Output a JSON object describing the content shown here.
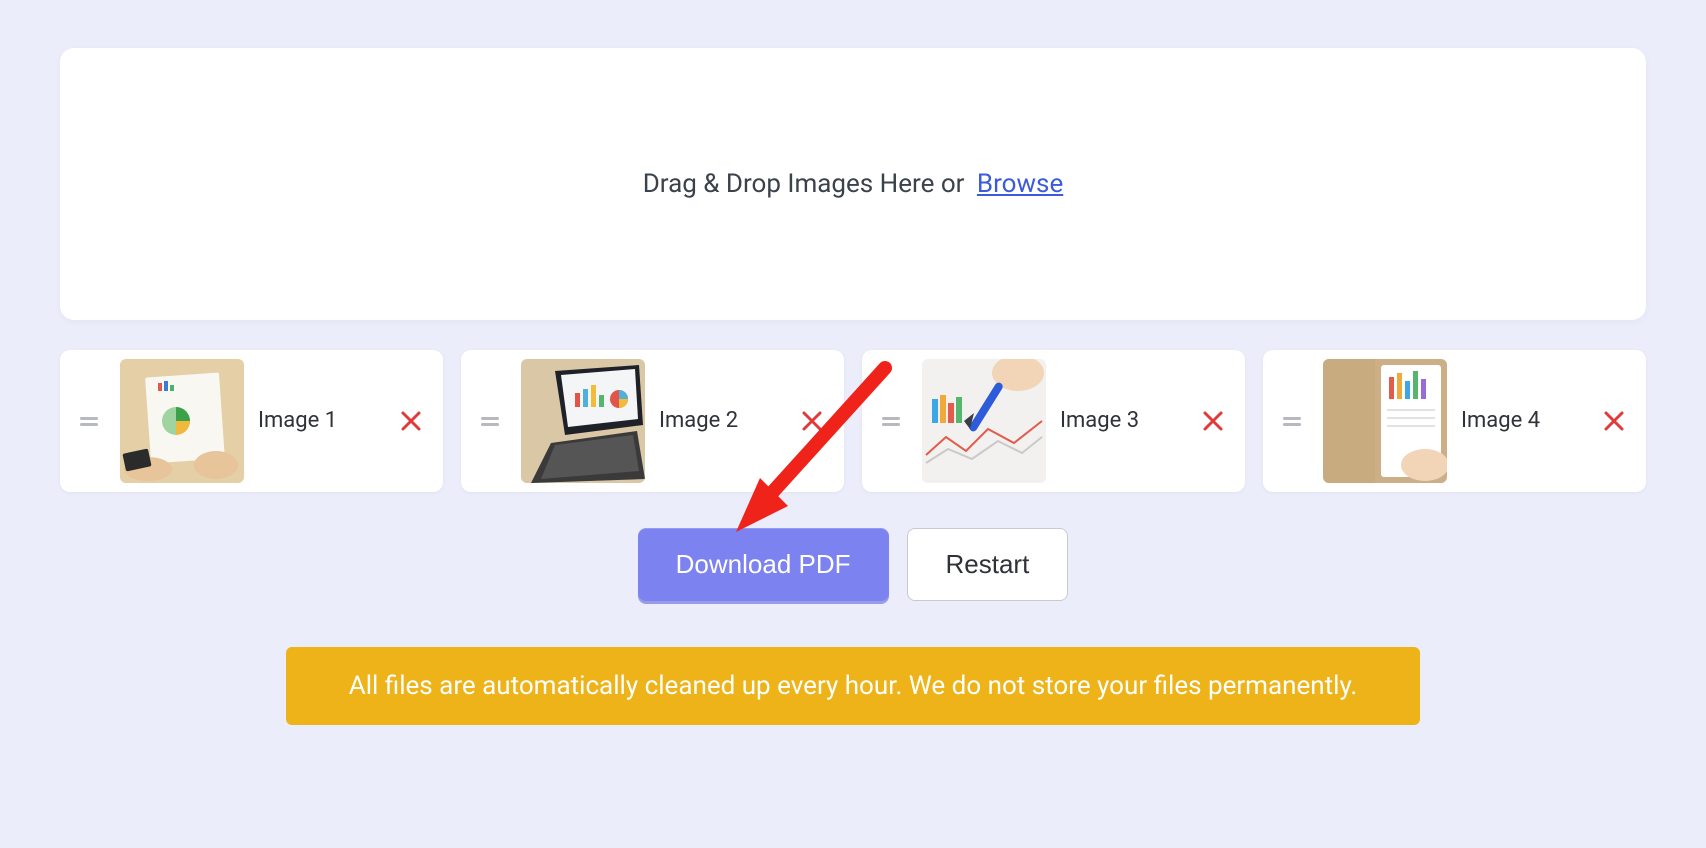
{
  "dropzone": {
    "instruction": "Drag & Drop Images Here or",
    "browse_label": "Browse"
  },
  "images": [
    {
      "label": "Image 1"
    },
    {
      "label": "Image 2"
    },
    {
      "label": "Image 3"
    },
    {
      "label": "Image 4"
    }
  ],
  "buttons": {
    "download": "Download PDF",
    "restart": "Restart"
  },
  "notice": "All files are automatically cleaned up every hour. We do not store your files permanently."
}
